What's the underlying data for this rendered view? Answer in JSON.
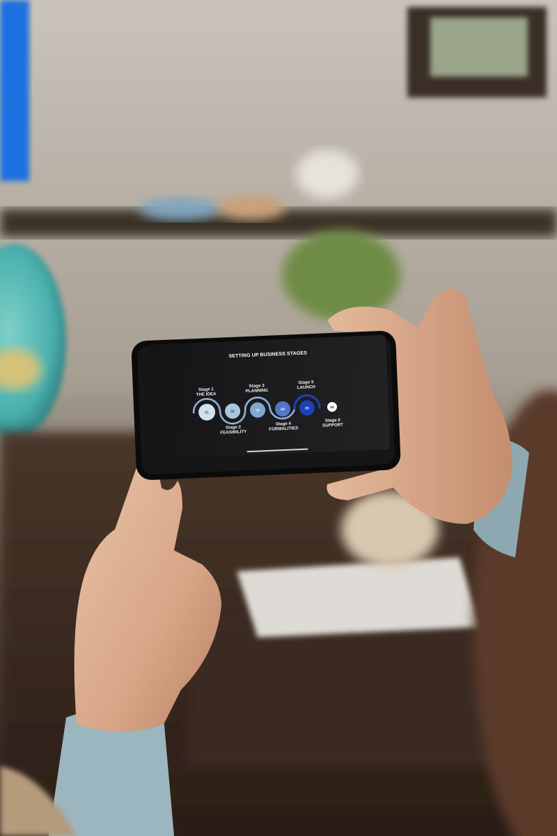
{
  "screen": {
    "title": "SETTING UP BUSINESS STAGES",
    "stages": [
      {
        "stage": "Stage 1",
        "name": "THE IDEA",
        "number": "01",
        "label_position": "top",
        "color": "#cfe0ee"
      },
      {
        "stage": "Stage 2",
        "name": "FEASIBILITY",
        "number": "02",
        "label_position": "bottom",
        "color": "#a9c6e0"
      },
      {
        "stage": "Stage 3",
        "name": "PLANNING",
        "number": "03",
        "label_position": "top",
        "color": "#7fa6d1"
      },
      {
        "stage": "Stage 4",
        "name": "FORMALITIES",
        "number": "04",
        "label_position": "bottom",
        "color": "#5576c7"
      },
      {
        "stage": "Stage 5",
        "name": "LAUNCH",
        "number": "05",
        "label_position": "top",
        "color": "#1d3fb8"
      },
      {
        "stage": "Stage 6",
        "name": "SUPPORT",
        "number": "06",
        "label_position": "bottom",
        "color": "#ffffff"
      }
    ]
  }
}
